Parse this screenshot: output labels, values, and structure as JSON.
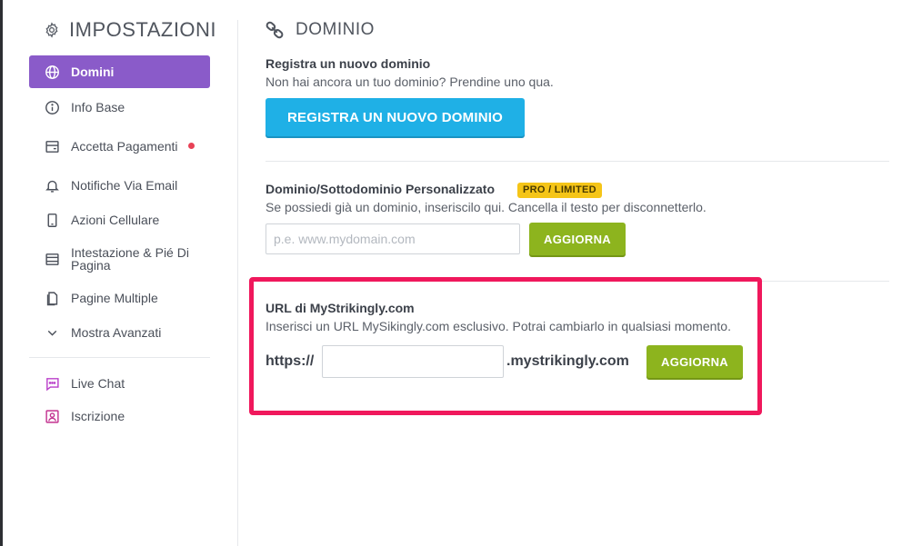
{
  "sidebar": {
    "title": "IMPOSTAZIONI",
    "items": [
      {
        "label": "Domini",
        "icon": "globe-icon"
      },
      {
        "label": "Info Base",
        "icon": "info-icon"
      },
      {
        "label": "Accetta Pagamenti",
        "icon": "payment-icon",
        "notification": true
      },
      {
        "label": "Notifiche Via Email",
        "icon": "bell-icon"
      },
      {
        "label": "Azioni Cellulare",
        "icon": "mobile-icon"
      },
      {
        "label": "Intestazione & Pié Di Pagina",
        "icon": "layout-icon"
      },
      {
        "label": "Pagine Multiple",
        "icon": "pages-icon"
      },
      {
        "label": "Mostra Avanzati",
        "icon": "chevron-down-icon"
      },
      {
        "label": "Live Chat",
        "icon": "chat-icon"
      },
      {
        "label": "Iscrizione",
        "icon": "signup-icon"
      }
    ]
  },
  "main": {
    "title": "DOMINIO",
    "register": {
      "title": "Registra un nuovo dominio",
      "desc": "Non hai ancora un tuo dominio? Prendine uno qua.",
      "button": "REGISTRA UN NUOVO DOMINIO"
    },
    "custom": {
      "title": "Dominio/Sottodominio Personalizzato",
      "badge": "PRO / LIMITED",
      "desc": "Se possiedi già un dominio, inseriscilo qui. Cancella il testo per disconnetterlo.",
      "placeholder": "p.e. www.mydomain.com",
      "button": "AGGIORNA"
    },
    "strikingly": {
      "title": "URL di MyStrikingly.com",
      "desc": "Inserisci un URL MySikingly.com esclusivo. Potrai cambiarlo in qualsiasi momento.",
      "prefix": "https://",
      "value": "",
      "suffix": ".mystrikingly.com",
      "button": "AGGIORNA"
    }
  },
  "colors": {
    "accent_purple": "#8a5bc9",
    "button_blue": "#1fb0e6",
    "button_green": "#8db41e",
    "badge_yellow": "#f5c518",
    "highlight": "#f0185c",
    "notification_red": "#e84156"
  }
}
